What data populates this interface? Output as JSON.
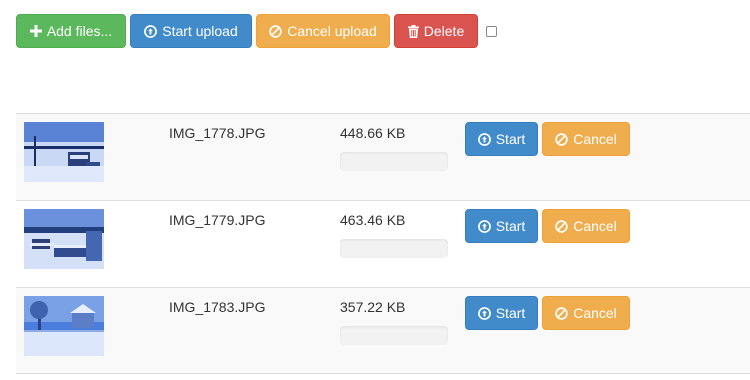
{
  "toolbar": {
    "add_label": "Add files...",
    "start_label": "Start upload",
    "cancel_label": "Cancel upload",
    "delete_label": "Delete"
  },
  "files": [
    {
      "name": "IMG_1778.JPG",
      "size": "448.66 KB",
      "progress": 0,
      "start_label": "Start",
      "cancel_label": "Cancel"
    },
    {
      "name": "IMG_1779.JPG",
      "size": "463.46 KB",
      "progress": 0,
      "start_label": "Start",
      "cancel_label": "Cancel"
    },
    {
      "name": "IMG_1783.JPG",
      "size": "357.22 KB",
      "progress": 0,
      "start_label": "Start",
      "cancel_label": "Cancel"
    }
  ],
  "colors": {
    "success": "#5cb85c",
    "primary": "#428bca",
    "warning": "#f0ad4e",
    "danger": "#d9534f"
  },
  "icons": {
    "add": "plus-icon",
    "start": "circle-arrow-up-icon",
    "cancel": "ban-circle-icon",
    "delete": "trash-icon"
  }
}
